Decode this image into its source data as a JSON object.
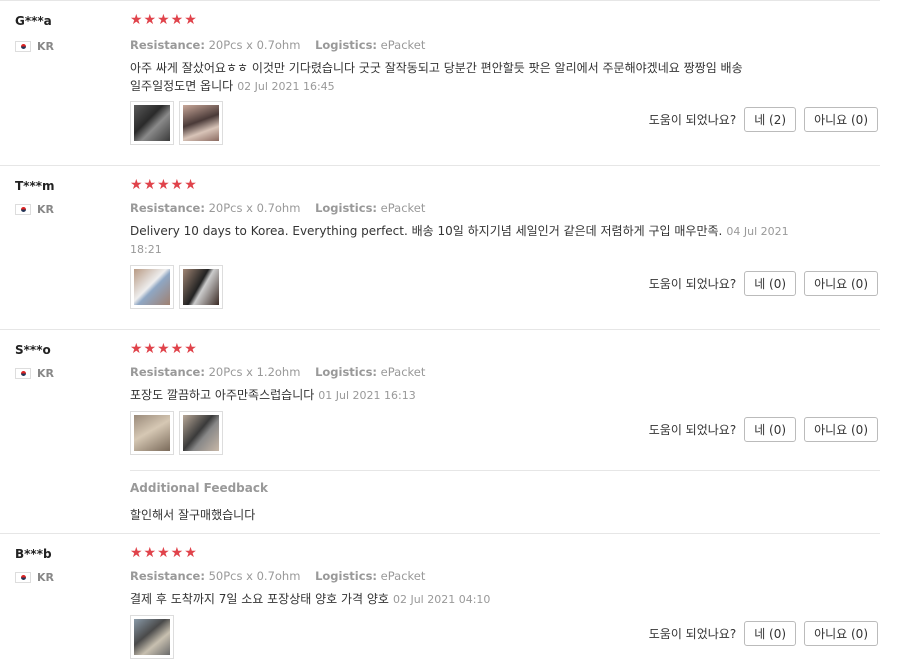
{
  "helpful_label": "도움이 되었나요?",
  "resistance_label": "Resistance:",
  "logistics_label": "Logistics:",
  "star_glyph": "★★★★★",
  "reviews": [
    {
      "user": "G***a",
      "country": "KR",
      "stars": 5,
      "resistance": "20Pcs x 0.7ohm",
      "logistics": "ePacket",
      "text_line1": "아주 싸게 잘샀어요ㅎㅎ 이것만 기다렸습니다 굿굿 잘작동되고 당분간 편안할듯 팟은 알리에서 주문해야겠네요 짱짱임 배송",
      "text_line2": "일주일정도면 옵니다",
      "date": "02 Jul 2021 16:45",
      "yes": "네 (2)",
      "no": "아니요 (0)"
    },
    {
      "user": "T***m",
      "country": "KR",
      "stars": 5,
      "resistance": "20Pcs x 0.7ohm",
      "logistics": "ePacket",
      "text_line1": "Delivery 10 days to Korea. Everything perfect. 배송 10일 하지기념 세일인거 같은데 저렴하게 구입 매우만족.",
      "date_part1": "04 Jul 2021",
      "date_part2": "18:21",
      "yes": "네 (0)",
      "no": "아니요 (0)"
    },
    {
      "user": "S***o",
      "country": "KR",
      "stars": 5,
      "resistance": "20Pcs x 1.2ohm",
      "logistics": "ePacket",
      "text_line1": "포장도 깔끔하고 아주만족스럽습니다",
      "date": "01 Jul 2021 16:13",
      "yes": "네 (0)",
      "no": "아니요 (0)",
      "additional_title": "Additional Feedback",
      "additional_text": "할인해서 잘구매했습니다"
    },
    {
      "user": "B***b",
      "country": "KR",
      "stars": 5,
      "resistance": "50Pcs x 0.7ohm",
      "logistics": "ePacket",
      "text_line1": "결제 후 도착까지 7일 소요 포장상태 양호 가격 양호",
      "date": "02 Jul 2021 04:10",
      "yes": "네 (0)",
      "no": "아니요 (0)"
    }
  ]
}
